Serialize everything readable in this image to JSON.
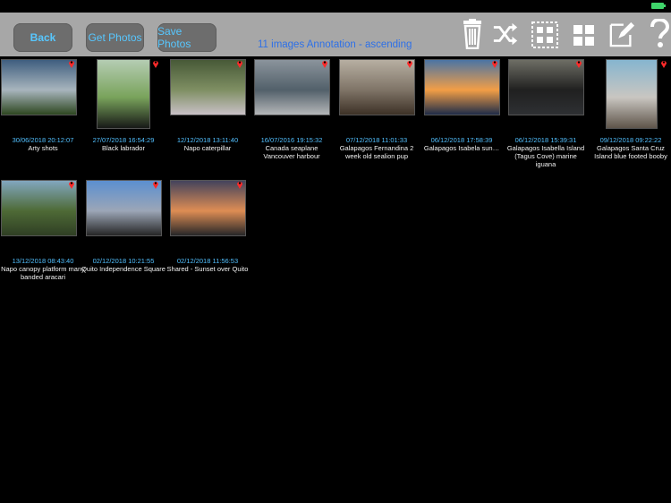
{
  "toolbar": {
    "back_label": "Back",
    "get_photos_label": "Get Photos",
    "save_photos_label": "Save Photos",
    "summary": "11 images  Annotation - ascending",
    "tools": [
      "trash-icon",
      "shuffle-icon",
      "select-grid-icon",
      "grid-view-icon",
      "annotate-icon",
      "help-icon"
    ]
  },
  "photos": [
    {
      "date": "30/06/2018 20:12:07",
      "caption": "Arty shots",
      "colors": [
        "#3f5e7f",
        "#a8b5bd",
        "#2e4720"
      ]
    },
    {
      "date": "27/07/2018 16:54:29",
      "caption": "Black labrador",
      "colors": [
        "#b5cdb3",
        "#79a35b",
        "#171917"
      ]
    },
    {
      "date": "12/12/2018 13:11:40",
      "caption": "Napo caterpillar",
      "colors": [
        "#475937",
        "#7f8f63",
        "#c8c0c6"
      ]
    },
    {
      "date": "16/07/2016 19:15:32",
      "caption": "Canada seaplane Vancouver harbour",
      "colors": [
        "#8b949c",
        "#52606a",
        "#b4b6b8"
      ]
    },
    {
      "date": "07/12/2018 11:01:33",
      "caption": "Galapagos Fernandina 2 week old sealion pup",
      "colors": [
        "#b7afa2",
        "#7f7467",
        "#3d3126"
      ]
    },
    {
      "date": "06/12/2018 17:58:39",
      "caption": "Galapagos Isabela sun…",
      "colors": [
        "#4a74a4",
        "#f29e46",
        "#1e2c48"
      ]
    },
    {
      "date": "06/12/2018 15:39:31",
      "caption": "Galapagos Isabella Island (Tagus Cove) marine iguana",
      "colors": [
        "#6e6e65",
        "#202020",
        "#2e3033"
      ]
    },
    {
      "date": "09/12/2018 09:22:22",
      "caption": "Galapagos Santa Cruz Island blue footed booby",
      "colors": [
        "#86b5cf",
        "#c9c6c1",
        "#5f554a"
      ]
    },
    {
      "date": "13/12/2018 08:43:40",
      "caption": "Napo canopy platform many banded aracari",
      "colors": [
        "#82a7bf",
        "#4e6a36",
        "#2f3f24"
      ]
    },
    {
      "date": "02/12/2018 10:21:55",
      "caption": "Quito Independence Square",
      "colors": [
        "#5b8fd0",
        "#9ca6b7",
        "#262626"
      ]
    },
    {
      "date": "02/12/2018 11:56:53",
      "caption": "Shared - Sunset over Quito",
      "colors": [
        "#43435c",
        "#de8d54",
        "#262628"
      ]
    }
  ]
}
